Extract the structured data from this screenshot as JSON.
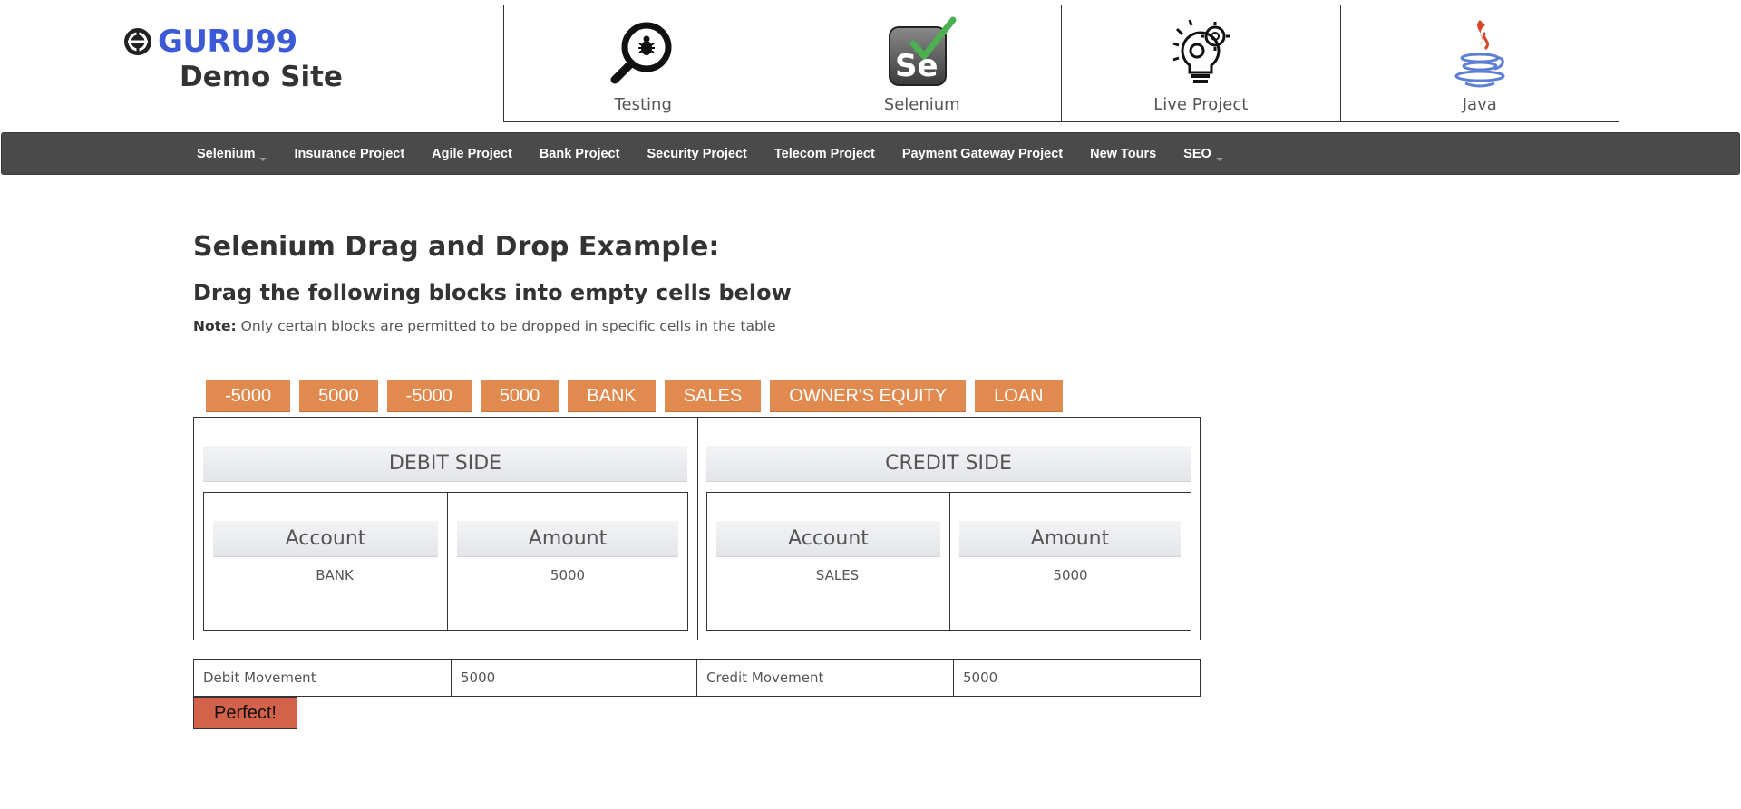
{
  "logo": {
    "brand": "GURU99",
    "subtitle": "Demo Site"
  },
  "categories": [
    {
      "label": "Testing",
      "icon": "magnifier-bug-icon"
    },
    {
      "label": "Selenium",
      "icon": "selenium-logo-icon"
    },
    {
      "label": "Live Project",
      "icon": "lightbulb-gears-icon"
    },
    {
      "label": "Java",
      "icon": "java-cup-icon"
    }
  ],
  "nav": {
    "items": [
      {
        "label": "Selenium",
        "dropdown": true
      },
      {
        "label": "Insurance Project",
        "dropdown": false
      },
      {
        "label": "Agile Project",
        "dropdown": false
      },
      {
        "label": "Bank Project",
        "dropdown": false
      },
      {
        "label": "Security Project",
        "dropdown": false
      },
      {
        "label": "Telecom Project",
        "dropdown": false
      },
      {
        "label": "Payment Gateway Project",
        "dropdown": false
      },
      {
        "label": "New Tours",
        "dropdown": false
      },
      {
        "label": "SEO",
        "dropdown": true
      }
    ]
  },
  "content": {
    "title": "Selenium Drag and Drop Example:",
    "subtitle": "Drag the following blocks into empty cells below",
    "note_label": "Note:",
    "note_text": " Only certain blocks are permitted to be dropped in specific cells in the table"
  },
  "blocks": [
    "-5000",
    "5000",
    "-5000",
    "5000",
    "BANK",
    "SALES",
    "OWNER'S EQUITY",
    "LOAN"
  ],
  "debit": {
    "heading": "DEBIT SIDE",
    "account_header": "Account",
    "amount_header": "Amount",
    "account_value": "BANK",
    "amount_value": "5000"
  },
  "credit": {
    "heading": "CREDIT SIDE",
    "account_header": "Account",
    "amount_header": "Amount",
    "account_value": "SALES",
    "amount_value": "5000"
  },
  "movement": {
    "debit_label": "Debit Movement",
    "debit_value": "5000",
    "credit_label": "Credit Movement",
    "credit_value": "5000"
  },
  "result_button": "Perfect!",
  "colors": {
    "brand": "#3d5ad6",
    "navbar": "#4a4a4a",
    "block": "#e08a50",
    "result": "#d4624a"
  }
}
